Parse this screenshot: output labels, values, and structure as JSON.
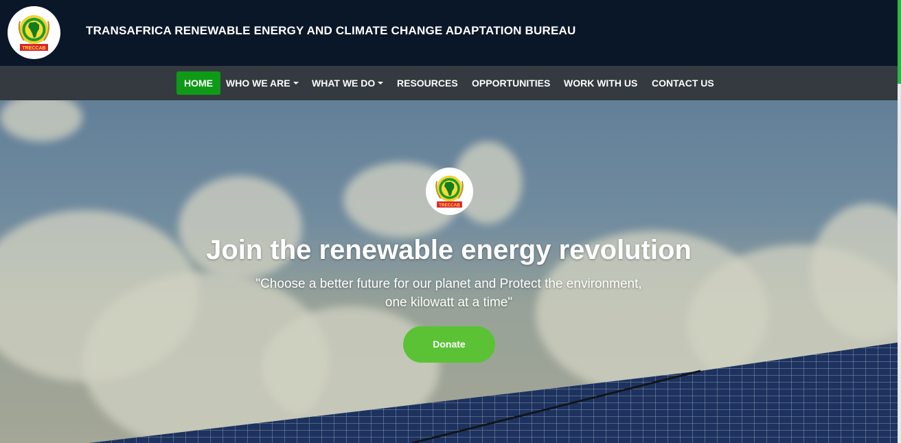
{
  "header": {
    "title": "TRANSAFRICA RENEWABLE ENERGY AND CLIMATE CHANGE ADAPTATION BUREAU",
    "logo_text": "TRECCAB"
  },
  "nav": {
    "items": [
      {
        "label": "HOME",
        "active": true
      },
      {
        "label": "WHO WE ARE",
        "dropdown": true
      },
      {
        "label": "WHAT WE DO",
        "dropdown": true
      },
      {
        "label": "RESOURCES"
      },
      {
        "label": "OPPORTUNITIES"
      },
      {
        "label": "WORK WITH US"
      },
      {
        "label": "CONTACT US"
      }
    ]
  },
  "hero": {
    "heading": "Join the renewable energy revolution",
    "quote_line1": "\"Choose a better future for our planet and Protect the environment,",
    "quote_line2": "one kilowatt at a time\"",
    "donate_label": "Donate",
    "logo_text": "TRECCAB"
  },
  "colors": {
    "topbar": "#0a1729",
    "navbar": "#343a40",
    "active_nav": "#0e9a17",
    "donate": "#5bc236",
    "scroll_thumb": "#2fb34a"
  },
  "icons": {
    "logo": "treccab-africa-emblem",
    "caret": "chevron-down-icon"
  }
}
